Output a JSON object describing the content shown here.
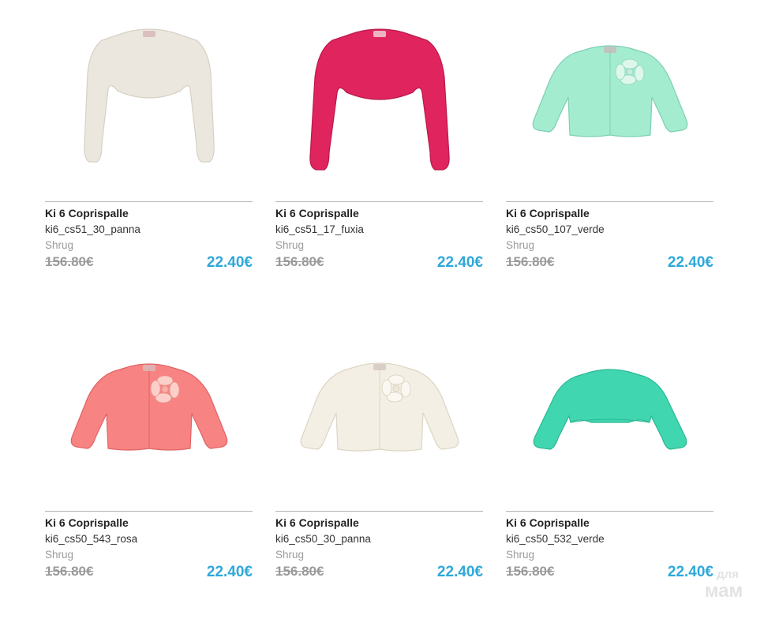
{
  "products": [
    {
      "brand": "Ki 6 Coprispalle",
      "sku": "ki6_cs51_30_panna",
      "category": "Shrug",
      "old_price": "156.80€",
      "new_price": "22.40€",
      "image_icon": "shrug-garment-icon",
      "color": "#ece7de"
    },
    {
      "brand": "Ki 6 Coprispalle",
      "sku": "ki6_cs51_17_fuxia",
      "category": "Shrug",
      "old_price": "156.80€",
      "new_price": "22.40€",
      "image_icon": "shrug-garment-icon",
      "color": "#e0245e"
    },
    {
      "brand": "Ki 6 Coprispalle",
      "sku": "ki6_cs50_107_verde",
      "category": "Shrug",
      "old_price": "156.80€",
      "new_price": "22.40€",
      "image_icon": "cardigan-garment-icon",
      "color": "#a3ecd0"
    },
    {
      "brand": "Ki 6 Coprispalle",
      "sku": "ki6_cs50_543_rosa",
      "category": "Shrug",
      "old_price": "156.80€",
      "new_price": "22.40€",
      "image_icon": "cardigan-garment-icon",
      "color": "#f78383"
    },
    {
      "brand": "Ki 6 Coprispalle",
      "sku": "ki6_cs50_30_panna",
      "category": "Shrug",
      "old_price": "156.80€",
      "new_price": "22.40€",
      "image_icon": "cardigan-garment-icon",
      "color": "#f4efe4"
    },
    {
      "brand": "Ki 6 Coprispalle",
      "sku": "ki6_cs50_532_verde",
      "category": "Shrug",
      "old_price": "156.80€",
      "new_price": "22.40€",
      "image_icon": "cardigan-garment-icon",
      "color": "#40d6b0"
    }
  ],
  "colors": {
    "price_accent": "#2fa8d8",
    "muted_text": "#9a9a9a",
    "divider": "#b3b3b3"
  },
  "watermark": {
    "text_top": "для",
    "text_bottom": "мам"
  }
}
